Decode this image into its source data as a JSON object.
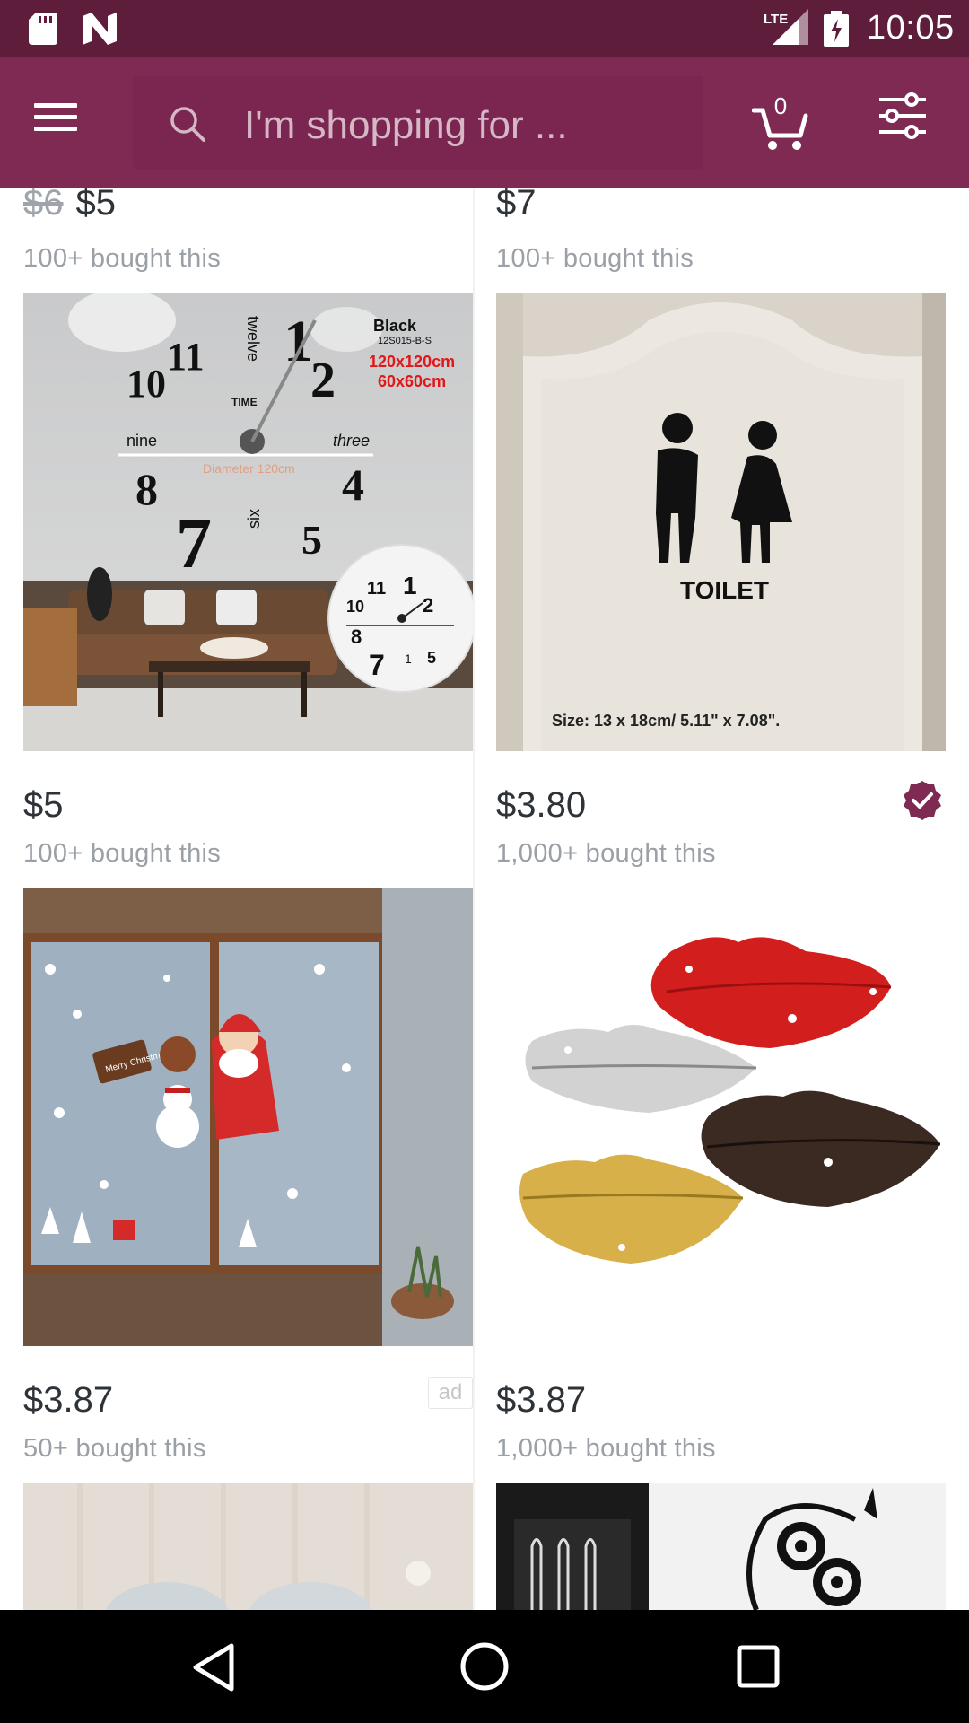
{
  "status_bar": {
    "network": "LTE",
    "time": "10:05",
    "icons": [
      "sd-card-icon",
      "n-notification-icon",
      "lte-signal-icon",
      "battery-charging-icon"
    ]
  },
  "toolbar": {
    "search_placeholder": "I'm shopping for ...",
    "cart_count": "0",
    "icons": [
      "menu-icon",
      "search-icon",
      "cart-icon",
      "filter-icon"
    ]
  },
  "products": [
    {
      "old_price": "$6",
      "price": "$5",
      "bought": "100+ bought this"
    },
    {
      "price": "$7",
      "bought": "100+ bought this"
    },
    {
      "price": "$5",
      "bought": "100+ bought this",
      "image_text": {
        "color": "Black",
        "sku": "12S015-B-S",
        "size1": "120x120cm",
        "size2": "60x60cm",
        "diameter": "Diameter 120cm",
        "twelve": "twelve",
        "time": "TIME",
        "nine": "nine",
        "three": "three",
        "six": "six"
      }
    },
    {
      "price": "$3.80",
      "bought": "1,000+ bought this",
      "verified": true,
      "image_text": {
        "label": "TOILET",
        "size": "Size: 13 x 18cm/ 5.11\" x 7.08\"."
      }
    },
    {
      "price": "$3.87",
      "bought": "50+ bought this",
      "ad_label": "ad",
      "image_text": {
        "sign": "Merry Christmas"
      }
    },
    {
      "price": "$3.87",
      "bought": "1,000+ bought this"
    }
  ],
  "colors": {
    "status_bar": "#5e1e3b",
    "toolbar": "#7e2a53",
    "verified_badge": "#7e2a53",
    "price_text": "#2e3338",
    "muted_text": "#9aa0a6"
  },
  "nav_bar": {
    "icons": [
      "back-icon",
      "home-icon",
      "recent-apps-icon"
    ]
  }
}
